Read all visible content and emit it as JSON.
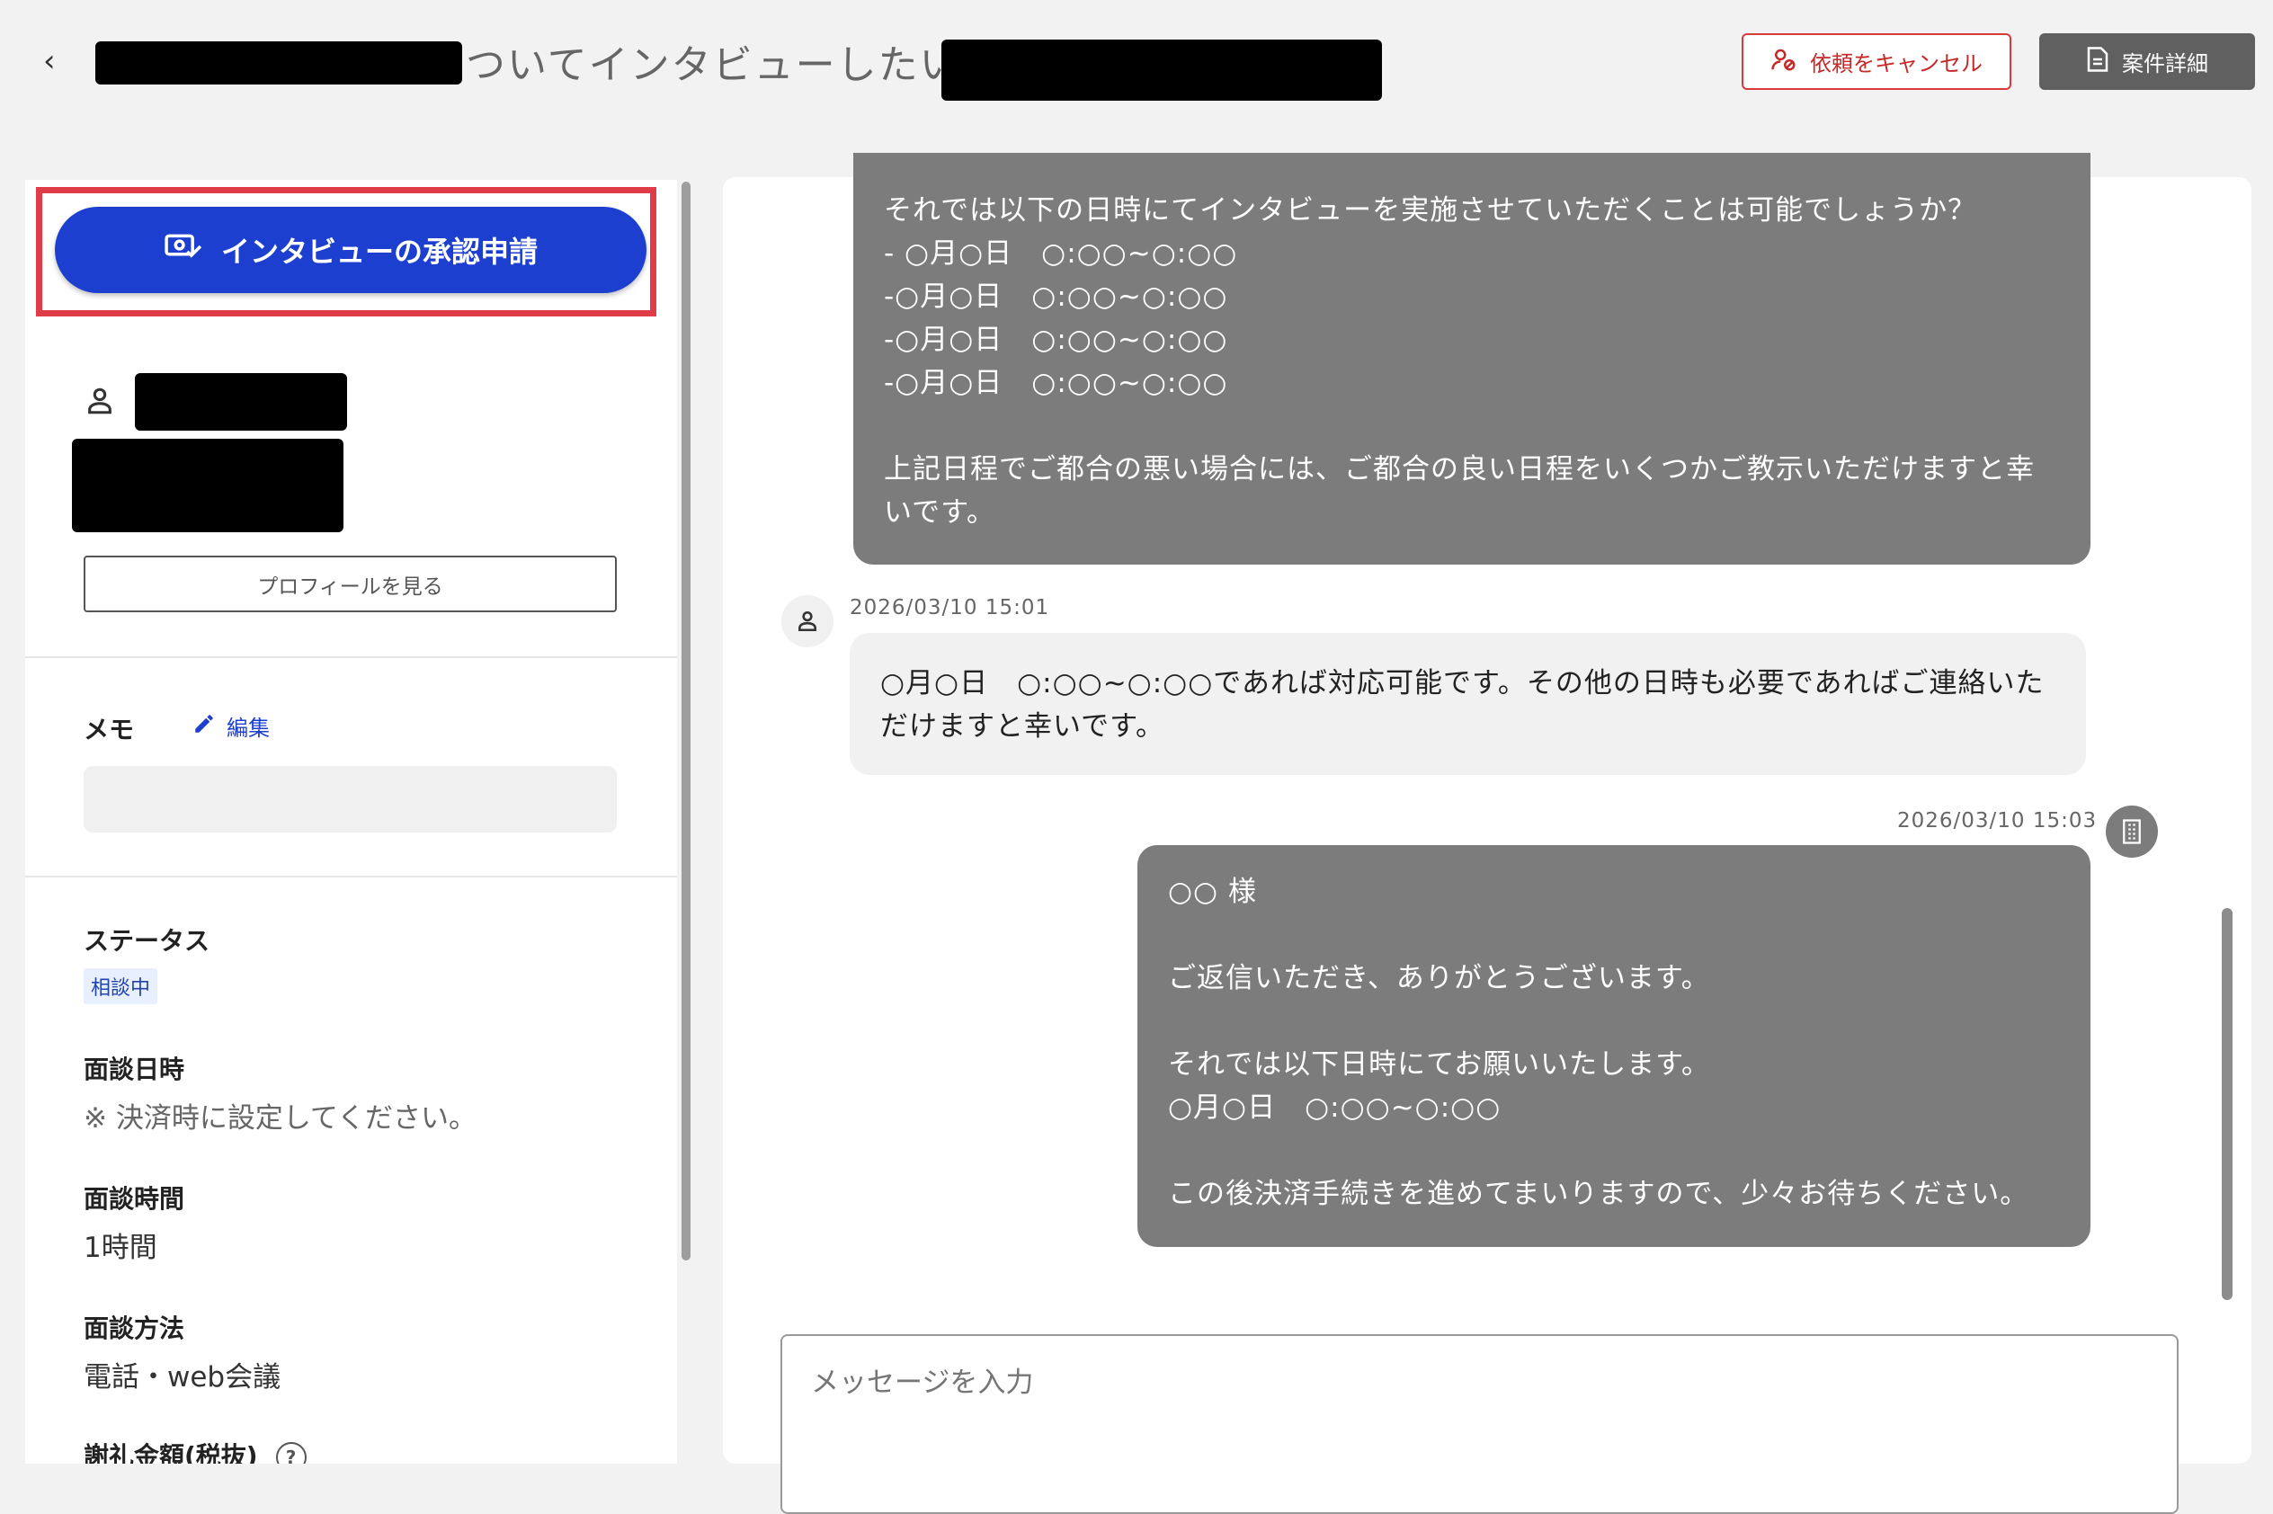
{
  "header": {
    "title_visible": "ついてインタビューしたい /",
    "cancel_label": "依頼をキャンセル",
    "detail_label": "案件詳細"
  },
  "sidebar": {
    "approve_label": "インタビューの承認申請",
    "profile_label": "プロフィールを見る",
    "memo_label": "メモ",
    "memo_edit_label": "編集",
    "status_label": "ステータス",
    "status_value": "相談中",
    "date_label": "面談日時",
    "date_value": "※ 決済時に設定してください。",
    "duration_label": "面談時間",
    "duration_value": "1時間",
    "method_label": "面談方法",
    "method_value": "電話・web会議",
    "fee_label": "謝礼金額(税抜)"
  },
  "chat": {
    "messages": [
      {
        "text": "それでは以下の日時にてインタビューを実施させていただくことは可能でしょうか？\n- ○月○日　○:○○~○:○○\n-○月○日　○:○○~○:○○\n-○月○日　○:○○~○:○○\n-○月○日　○:○○~○:○○\n\n上記日程でご都合の悪い場合には、ご都合の良い日程をいくつかご教示いただけますと幸いです。"
      },
      {
        "timestamp": "2026/03/10 15:01",
        "text": "○月○日　○:○○~○:○○であれば対応可能です。その他の日時も必要であればご連絡いただけますと幸いです。"
      },
      {
        "timestamp": "2026/03/10 15:03",
        "text": "○○ 様\n\nご返信いただき、ありがとうございます。\n\nそれでは以下日時にてお願いいたします。\n○月○日　○:○○~○:○○\n\nこの後決済手続きを進めてまいりますので、少々お待ちください。"
      }
    ],
    "input_placeholder": "メッセージを入力"
  },
  "colors": {
    "primary": "#1d3fd0",
    "highlight_border": "#e03b48",
    "cancel_red": "#c62828",
    "bubble_gray": "#7c7c7c"
  },
  "icons": [
    "back-chevron-icon",
    "person-remove-icon",
    "document-icon",
    "approval-icon",
    "person-icon",
    "pencil-icon",
    "help-icon",
    "building-icon"
  ]
}
